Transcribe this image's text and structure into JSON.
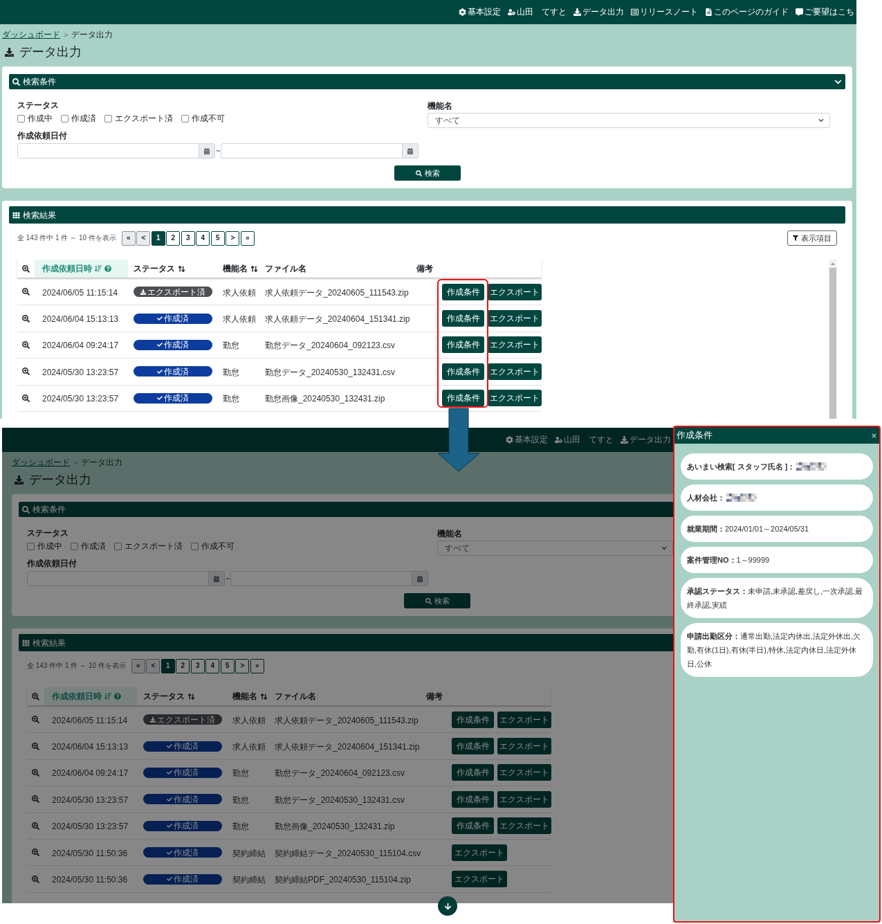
{
  "top_screen": {
    "dimmed": false,
    "nav": [
      {
        "kind": "settings",
        "label": "基本設定"
      },
      {
        "kind": "user",
        "label": "山田　てすと"
      },
      {
        "kind": "download",
        "label": "データ出力"
      },
      {
        "kind": "notes",
        "label": "リリースノート"
      },
      {
        "kind": "guide",
        "label": "このページのガイド"
      },
      {
        "kind": "feedback",
        "label": "ご要望はこち"
      }
    ],
    "breadcrumb": {
      "items": [
        {
          "label": "ダッシュボード",
          "link": true
        },
        {
          "label": "データ出力",
          "link": false
        }
      ],
      "separator": ">"
    },
    "title": "データ出力",
    "search": {
      "title": "検索条件",
      "status_label": "ステータス",
      "statuses": [
        {
          "label": "作成中",
          "checked": false
        },
        {
          "label": "作成済",
          "checked": false
        },
        {
          "label": "エクスポート済",
          "checked": false
        },
        {
          "label": "作成不可",
          "checked": false
        }
      ],
      "function_label": "機能名",
      "function_value": "すべて",
      "date_label": "作成依頼日付",
      "date_separator": "~",
      "button": "検索"
    },
    "results": {
      "title": "検索結果",
      "summary": "全 143 件中 1 件 ～ 10 件を表示",
      "pages": [
        {
          "label": "«",
          "selected": false,
          "disabled": true
        },
        {
          "label": "<",
          "selected": false,
          "disabled": true
        },
        {
          "label": "1",
          "selected": true,
          "disabled": false
        },
        {
          "label": "2",
          "selected": false,
          "disabled": false
        },
        {
          "label": "3",
          "selected": false,
          "disabled": false
        },
        {
          "label": "4",
          "selected": false,
          "disabled": false
        },
        {
          "label": "5",
          "selected": false,
          "disabled": false
        },
        {
          "label": ">",
          "selected": false,
          "disabled": false
        },
        {
          "label": "»",
          "selected": false,
          "disabled": false
        }
      ],
      "columns_button": "表示項目",
      "columns": [
        {
          "label": "作成依頼日時",
          "sorted": true,
          "sortable": true,
          "help": true
        },
        {
          "label": "ステータス",
          "sorted": false,
          "sortable": true,
          "help": false
        },
        {
          "label": "機能名",
          "sorted": false,
          "sortable": true,
          "help": false
        },
        {
          "label": "ファイル名",
          "sorted": false,
          "sortable": false,
          "help": false
        },
        {
          "label": "備考",
          "sorted": false,
          "sortable": false,
          "help": false
        }
      ],
      "rows": [
        {
          "datetime": "2024/06/05 11:15:14",
          "status": {
            "kind": "exported",
            "label": "エクスポート済"
          },
          "function": "求人依頼",
          "file": "求人依頼データ_20240605_111543.zip",
          "actions": [
            "作成条件",
            "エクスポート"
          ]
        },
        {
          "datetime": "2024/06/04 15:13:13",
          "status": {
            "kind": "created",
            "label": "作成済"
          },
          "function": "求人依頼",
          "file": "求人依頼データ_20240604_151341.zip",
          "actions": [
            "作成条件",
            "エクスポート"
          ]
        },
        {
          "datetime": "2024/06/04 09:24:17",
          "status": {
            "kind": "created",
            "label": "作成済"
          },
          "function": "勤怠",
          "file": "勤怠データ_20240604_092123.csv",
          "actions": [
            "作成条件",
            "エクスポート"
          ]
        },
        {
          "datetime": "2024/05/30 13:23:57",
          "status": {
            "kind": "created",
            "label": "作成済"
          },
          "function": "勤怠",
          "file": "勤怠データ_20240530_132431.csv",
          "actions": [
            "作成条件",
            "エクスポート"
          ]
        },
        {
          "datetime": "2024/05/30 13:23:57",
          "status": {
            "kind": "created",
            "label": "作成済"
          },
          "function": "勤怠",
          "file": "勤怠画像_20240530_132431.zip",
          "actions": [
            "作成条件",
            "エクスポート"
          ]
        }
      ]
    }
  },
  "bottom_screen": {
    "dimmed": true,
    "nav": [
      {
        "kind": "settings",
        "label": "基本設定"
      },
      {
        "kind": "user",
        "label": "山田　てすと"
      },
      {
        "kind": "download",
        "label": "データ出力"
      }
    ],
    "breadcrumb": {
      "items": [
        {
          "label": "ダッシュボード",
          "link": true
        },
        {
          "label": "データ出力",
          "link": false
        }
      ],
      "separator": ">"
    },
    "title": "データ出力",
    "search": {
      "title": "検索条件",
      "status_label": "ステータス",
      "statuses": [
        {
          "label": "作成中",
          "checked": false
        },
        {
          "label": "作成済",
          "checked": false
        },
        {
          "label": "エクスポート済",
          "checked": false
        },
        {
          "label": "作成不可",
          "checked": false
        }
      ],
      "function_label": "機能名",
      "function_value": "すべて",
      "date_label": "作成依頼日付",
      "date_separator": "~",
      "button": "検索"
    },
    "results": {
      "title": "検索結果",
      "summary": "全 143 件中 1 件 ～ 10 件を表示",
      "pages": [
        {
          "label": "«",
          "selected": false,
          "disabled": true
        },
        {
          "label": "<",
          "selected": false,
          "disabled": true
        },
        {
          "label": "1",
          "selected": true,
          "disabled": false
        },
        {
          "label": "2",
          "selected": false,
          "disabled": false
        },
        {
          "label": "3",
          "selected": false,
          "disabled": false
        },
        {
          "label": "4",
          "selected": false,
          "disabled": false
        },
        {
          "label": "5",
          "selected": false,
          "disabled": false
        },
        {
          "label": ">",
          "selected": false,
          "disabled": false
        },
        {
          "label": "»",
          "selected": false,
          "disabled": false
        }
      ],
      "columns": [
        {
          "label": "作成依頼日時",
          "sorted": true,
          "sortable": true,
          "help": true
        },
        {
          "label": "ステータス",
          "sorted": false,
          "sortable": true,
          "help": false
        },
        {
          "label": "機能名",
          "sorted": false,
          "sortable": true,
          "help": false
        },
        {
          "label": "ファイル名",
          "sorted": false,
          "sortable": false,
          "help": false
        },
        {
          "label": "備考",
          "sorted": false,
          "sortable": false,
          "help": false
        }
      ],
      "rows": [
        {
          "datetime": "2024/06/05 11:15:14",
          "status": {
            "kind": "exported",
            "label": "エクスポート済"
          },
          "function": "求人依頼",
          "file": "求人依頼データ_20240605_111543.zip",
          "actions": [
            "作成条件",
            "エクスポート"
          ]
        },
        {
          "datetime": "2024/06/04 15:13:13",
          "status": {
            "kind": "created",
            "label": "作成済"
          },
          "function": "求人依頼",
          "file": "求人依頼データ_20240604_151341.zip",
          "actions": [
            "作成条件",
            "エクスポート"
          ]
        },
        {
          "datetime": "2024/06/04 09:24:17",
          "status": {
            "kind": "created",
            "label": "作成済"
          },
          "function": "勤怠",
          "file": "勤怠データ_20240604_092123.csv",
          "actions": [
            "作成条件",
            "エクスポート"
          ]
        },
        {
          "datetime": "2024/05/30 13:23:57",
          "status": {
            "kind": "created",
            "label": "作成済"
          },
          "function": "勤怠",
          "file": "勤怠データ_20240530_132431.csv",
          "actions": [
            "作成条件",
            "エクスポート"
          ]
        },
        {
          "datetime": "2024/05/30 13:23:57",
          "status": {
            "kind": "created",
            "label": "作成済"
          },
          "function": "勤怠",
          "file": "勤怠画像_20240530_132431.zip",
          "actions": [
            "作成条件",
            "エクスポート"
          ]
        },
        {
          "datetime": "2024/05/30 11:50:36",
          "status": {
            "kind": "created",
            "label": "作成済"
          },
          "function": "契約締結",
          "file": "契約締結データ_20240530_115104.csv",
          "actions": [
            "エクスポート"
          ]
        },
        {
          "datetime": "2024/05/30 11:50:36",
          "status": {
            "kind": "created",
            "label": "作成済"
          },
          "function": "契約締結",
          "file": "契約締結PDF_20240530_115104.zip",
          "actions": [
            "エクスポート"
          ]
        }
      ]
    }
  },
  "dialog": {
    "title": "作成条件",
    "items": [
      {
        "kind": "redacted",
        "label": "あいまい検索[ スタッフ氏名 ]："
      },
      {
        "kind": "redacted",
        "label": "人材会社："
      },
      {
        "kind": "text",
        "label": "就業期間：",
        "value": "2024/01/01～2024/05/31"
      },
      {
        "kind": "text",
        "label": "案件管理NO：",
        "value": "1～99999"
      },
      {
        "kind": "text",
        "label": "承認ステータス：",
        "value": "未申請,未承認,差戻し,一次承認,最終承認,実績"
      },
      {
        "kind": "text",
        "label": "申請出勤区分：",
        "value": "通常出勤,法定内休出,法定外休出,欠勤,有休(1日),有休(半日),特休,法定内休日,法定外休日,公休"
      }
    ]
  }
}
